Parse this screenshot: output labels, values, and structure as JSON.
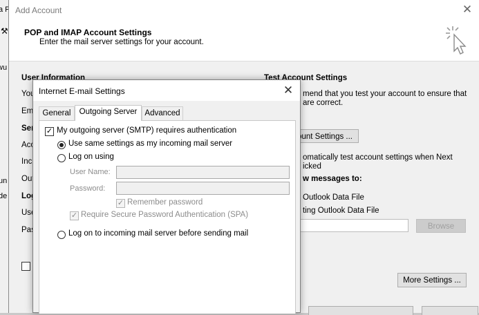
{
  "background": {
    "fragments": [
      "a F",
      "wu",
      "un",
      "de"
    ]
  },
  "add_account": {
    "title": "Add Account",
    "header_title": "POP and IMAP Account Settings",
    "header_subtitle": "Enter the mail server settings for your account.",
    "left_labels": [
      "User Information",
      "You",
      "Ema",
      "Ser",
      "Acc",
      "Inc",
      "Out",
      "Log",
      "Use",
      "Pas"
    ],
    "test_section_title": "Test Account Settings",
    "test_text_line1": "mend that you test your account to ensure that",
    "test_text_line2": "are correct.",
    "test_button": "ount Settings ...",
    "auto_test_line1": "omatically test account settings when Next",
    "auto_test_line2": "icked",
    "deliver_label": "w messages to:",
    "new_data_file": "Outlook Data File",
    "existing_data_file": "ting Outlook Data File",
    "browse_button": "Browse",
    "more_settings_button": "More Settings ..."
  },
  "dialog": {
    "title": "Internet E-mail Settings",
    "tabs": [
      "General",
      "Outgoing Server",
      "Advanced"
    ],
    "active_tab": "Outgoing Server",
    "smtp_auth_label": "My outgoing server (SMTP) requires authentication",
    "smtp_auth_checked": true,
    "radio_same": "Use same settings as my incoming mail server",
    "radio_logon": "Log on using",
    "username_label": "User Name:",
    "password_label": "Password:",
    "username_value": "",
    "password_value": "",
    "remember_password": "Remember password",
    "require_spa": "Require Secure Password Authentication (SPA)",
    "radio_incoming_first": "Log on to incoming mail server before sending mail",
    "selected_option": "Use same settings as my incoming mail server"
  }
}
